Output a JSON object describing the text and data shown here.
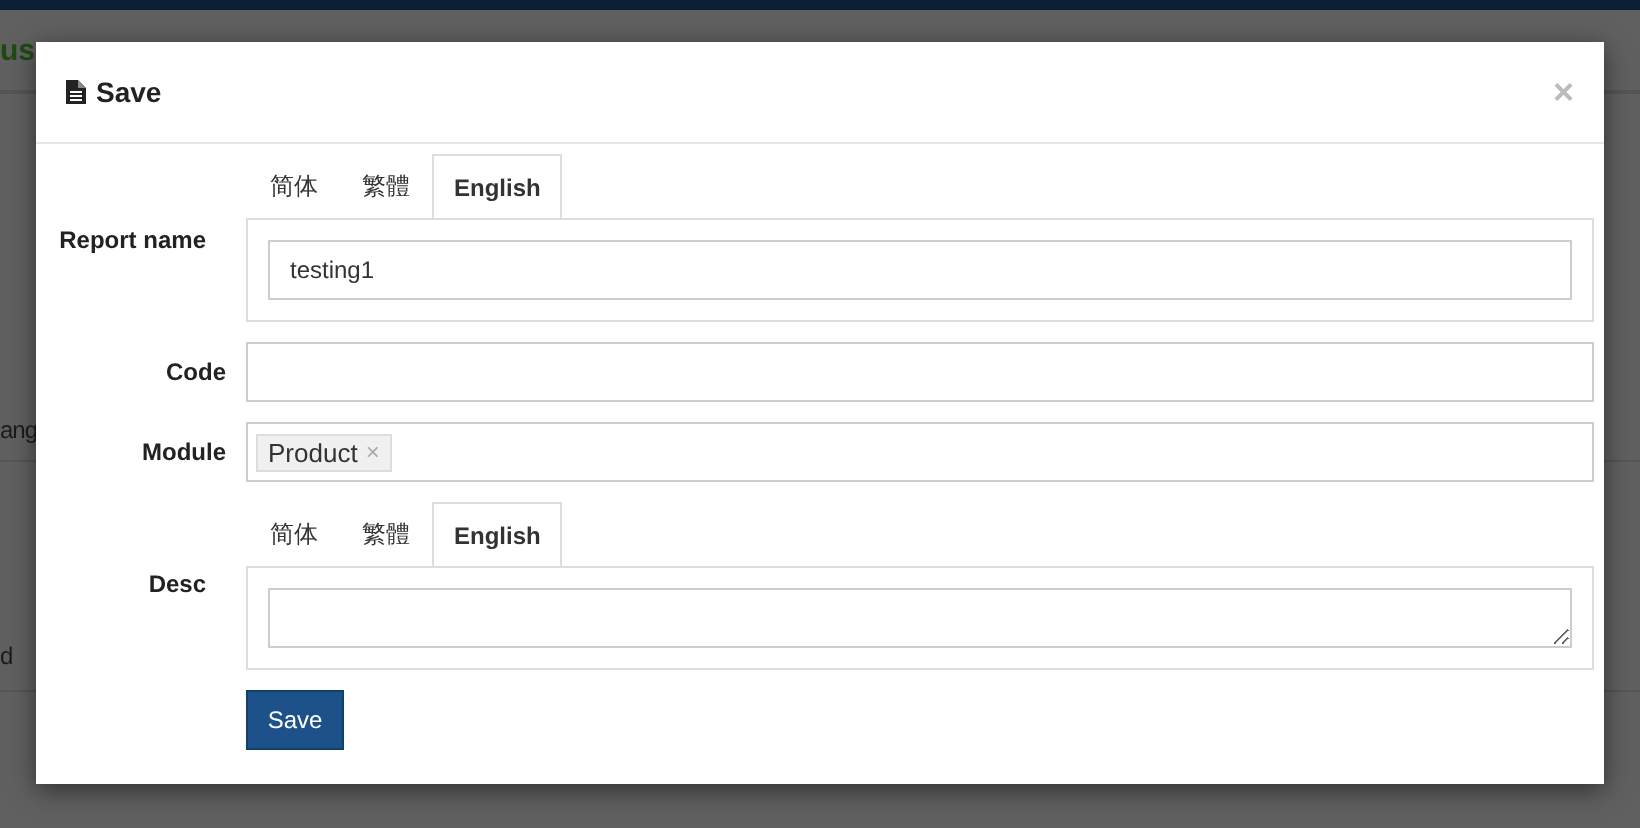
{
  "background": {
    "fragments": [
      {
        "text": "us",
        "kind": "heading"
      },
      {
        "text": "ang",
        "kind": "cell"
      },
      {
        "text": "d",
        "kind": "cell"
      }
    ]
  },
  "dialog": {
    "title": "Save",
    "close": "×",
    "fields": [
      {
        "kind": "translated-input",
        "label": "Report name",
        "tabs": [
          {
            "label": "简体",
            "selected": false
          },
          {
            "label": "繁體",
            "selected": false
          },
          {
            "label": "English",
            "selected": true
          }
        ],
        "value": "testing1"
      },
      {
        "kind": "input",
        "label": "Code"
      },
      {
        "kind": "tags",
        "label": "Module",
        "tags": [
          {
            "label": "Product",
            "remove": "×"
          }
        ]
      },
      {
        "kind": "translated-textarea",
        "label": "Desc",
        "tabs": [
          {
            "label": "简体",
            "selected": false
          },
          {
            "label": "繁體",
            "selected": false
          },
          {
            "label": "English",
            "selected": true
          }
        ]
      }
    ],
    "save_button": "Save"
  }
}
